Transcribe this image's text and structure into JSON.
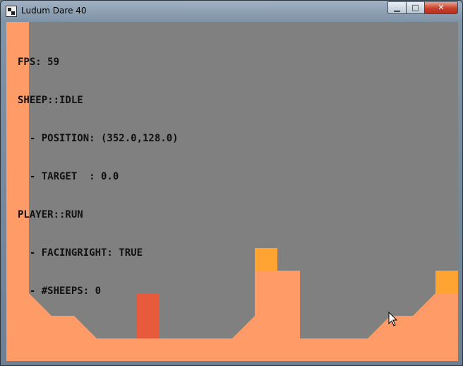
{
  "window": {
    "title": "Ludum Dare 40",
    "controls": {
      "minimize": "▁",
      "maximize": "□",
      "close": "✕"
    }
  },
  "hud": {
    "fps": "FPS: 59",
    "sheep_state": "SHEEP::IDLE",
    "sheep_position": "  - POSITION: (352.0,128.0)",
    "sheep_target": "  - TARGET  : 0.0",
    "player_state": "PLAYER::RUN",
    "player_facing": "  - FACINGRIGHT: TRUE",
    "player_sheeps": "  - #SHEEPS: 0"
  },
  "colors": {
    "background": "#808080",
    "terrain": "#fe9b67",
    "player": "#e75a3b",
    "pickup": "#ffa433"
  }
}
